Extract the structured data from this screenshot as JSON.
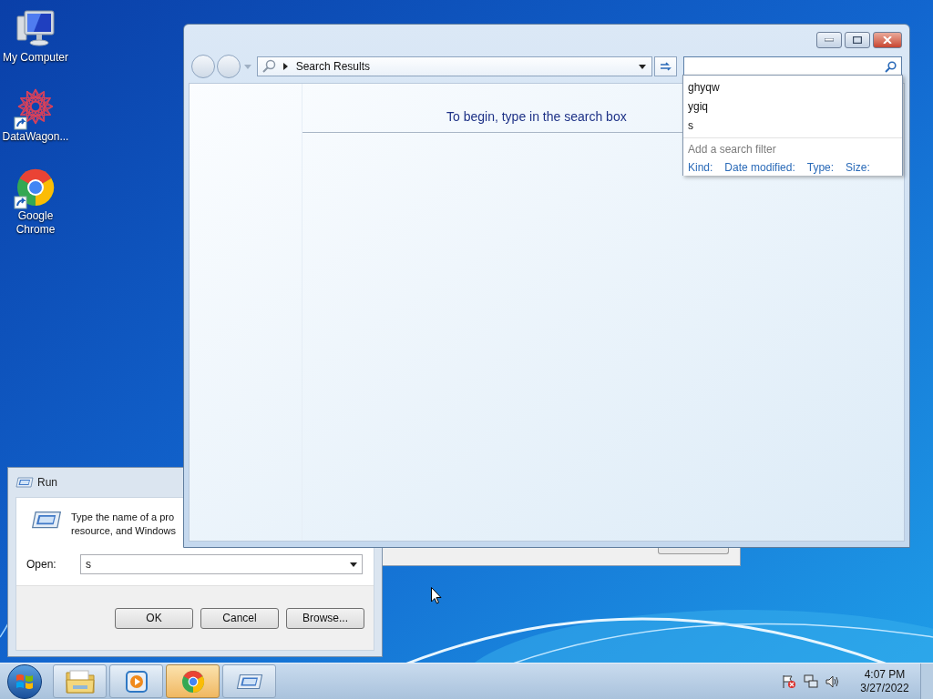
{
  "desktop_icons": [
    {
      "kind": "computer",
      "label": "My Computer"
    },
    {
      "kind": "datawagon",
      "label": "DataWagon..."
    },
    {
      "kind": "chrome",
      "label": "Google Chrome"
    }
  ],
  "explorer": {
    "address": "Search Results",
    "message": "To begin, type in the search box",
    "suggestions": [
      "ghyqw",
      "ygiq",
      "s"
    ],
    "filter_heading": "Add a search filter",
    "filters": [
      "Kind:",
      "Date modified:",
      "Type:",
      "Size:"
    ]
  },
  "run_dialog": {
    "title": "Run",
    "description_lines": [
      "Type the name of a pro",
      "resource, and Windows"
    ],
    "open_label": "Open:",
    "open_value": "s",
    "buttons": [
      "OK",
      "Cancel",
      "Browse..."
    ]
  },
  "taskbar": {
    "buttons": [
      {
        "kind": "folder",
        "selected": false
      },
      {
        "kind": "media",
        "selected": false
      },
      {
        "kind": "chrome",
        "selected": true
      },
      {
        "kind": "run",
        "selected": false
      }
    ],
    "time": "4:07 PM",
    "date": "3/27/2022"
  }
}
